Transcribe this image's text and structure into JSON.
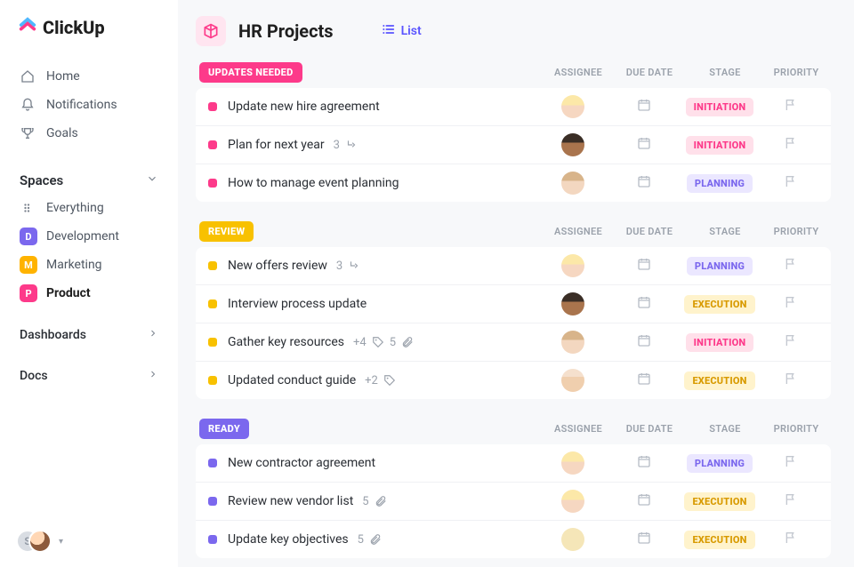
{
  "brand": "ClickUp",
  "sidebar": {
    "nav": [
      {
        "label": "Home"
      },
      {
        "label": "Notifications"
      },
      {
        "label": "Goals"
      }
    ],
    "spaces_header": "Spaces",
    "everything": "Everything",
    "spaces": [
      {
        "letter": "D",
        "label": "Development",
        "color": "#7b68ee"
      },
      {
        "letter": "M",
        "label": "Marketing",
        "color": "#ffb300"
      },
      {
        "letter": "P",
        "label": "Product",
        "color": "#fd3a8a",
        "active": true
      }
    ],
    "dashboards": "Dashboards",
    "docs": "Docs",
    "user_initial": "S"
  },
  "header": {
    "title": "HR Projects",
    "view": "List"
  },
  "columns": {
    "assignee": "ASSIGNEE",
    "duedate": "DUE DATE",
    "stage": "STAGE",
    "priority": "PRIORITY"
  },
  "stage_styles": {
    "INITIATION": {
      "bg": "#ffe0ea",
      "fg": "#fd3a8a"
    },
    "PLANNING": {
      "bg": "#ebe7ff",
      "fg": "#7b68ee"
    },
    "EXECUTION": {
      "bg": "#fff3cc",
      "fg": "#d89a00"
    }
  },
  "groups": [
    {
      "name": "UPDATES NEEDED",
      "pill_bg": "#fd3a8a",
      "dot": "#fd3a8a",
      "tasks": [
        {
          "title": "Update new hire agreement",
          "assignee": "blonde",
          "stage": "INITIATION"
        },
        {
          "title": "Plan for next year",
          "subtasks": 3,
          "assignee": "darkm",
          "stage": "INITIATION"
        },
        {
          "title": "How to manage event planning",
          "assignee": "lightm",
          "stage": "PLANNING"
        }
      ]
    },
    {
      "name": "REVIEW",
      "pill_bg": "#f8c100",
      "dot": "#f8c100",
      "tasks": [
        {
          "title": "New offers review",
          "subtasks": 3,
          "assignee": "blonde",
          "stage": "PLANNING"
        },
        {
          "title": "Interview process update",
          "assignee": "darkm",
          "stage": "EXECUTION"
        },
        {
          "title": "Gather key resources",
          "extra_assignees": 4,
          "attachments": 5,
          "assignee": "lightm",
          "stage": "INITIATION"
        },
        {
          "title": "Updated conduct guide",
          "extra_assignees": 2,
          "assignee": "bald",
          "stage": "EXECUTION"
        }
      ]
    },
    {
      "name": "READY",
      "pill_bg": "#7b68ee",
      "dot": "#7b68ee",
      "tasks": [
        {
          "title": "New contractor agreement",
          "assignee": "blonde",
          "stage": "PLANNING"
        },
        {
          "title": "Review new vendor list",
          "attachments": 5,
          "assignee": "blonde",
          "stage": "EXECUTION"
        },
        {
          "title": "Update key objectives",
          "attachments": 5,
          "assignee": "g2",
          "stage": "EXECUTION"
        }
      ]
    }
  ]
}
